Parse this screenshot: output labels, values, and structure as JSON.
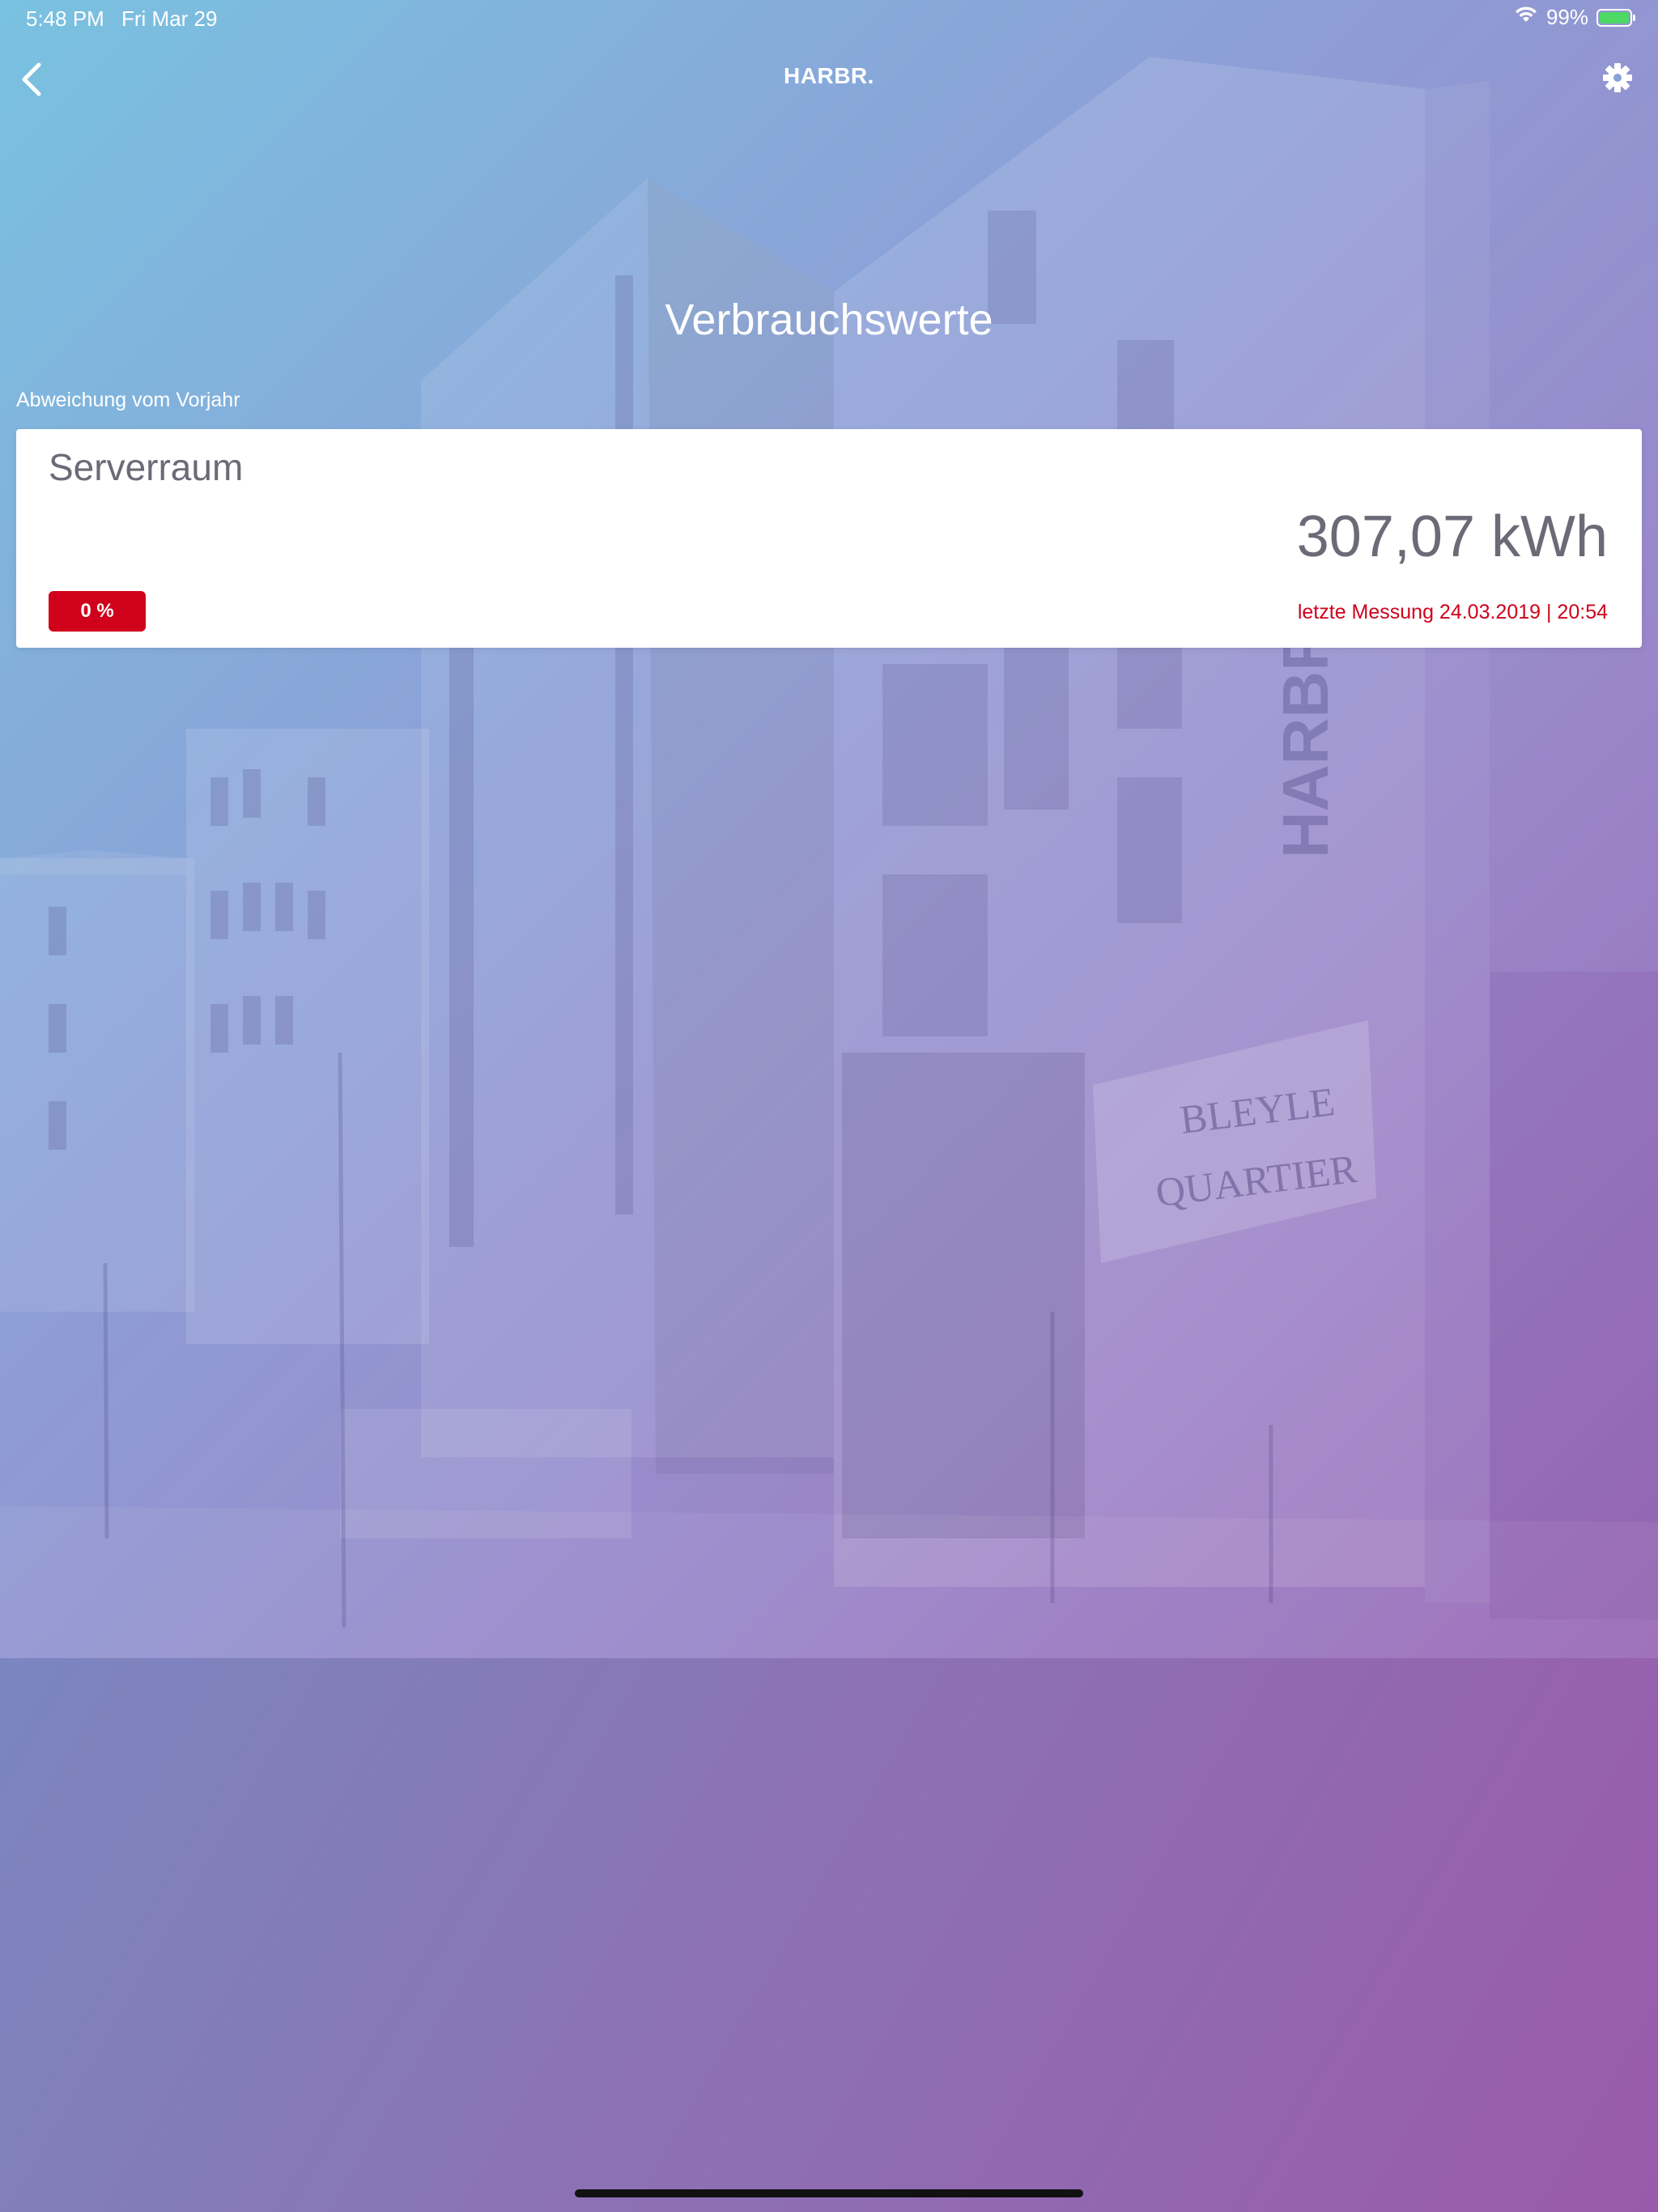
{
  "status_bar": {
    "time": "5:48 PM",
    "date": "Fri Mar 29",
    "battery_percent": "99%",
    "battery_level": 0.99,
    "wifi_icon": "wifi-icon",
    "battery_icon": "battery-charging-icon"
  },
  "nav": {
    "title": "HARBR.",
    "back_icon": "chevron-left-icon",
    "settings_icon": "gear-icon"
  },
  "main": {
    "heading": "Verbrauchswerte",
    "caption": "Abweichung vom Vorjahr",
    "card": {
      "name": "Serverraum",
      "value": "307,07 kWh",
      "deviation": "0 %",
      "last_measurement": "letzte Messung 24.03.2019 | 20:54"
    }
  },
  "background": {
    "sign_text_1": "BLEYLE",
    "sign_text_2": "QUARTIER",
    "facade_logo": "HARBR."
  },
  "colors": {
    "accent_red": "#d0021b",
    "card_text": "#6b6b78",
    "gradient_start": "#79c2e0",
    "gradient_end": "#9b5aae"
  }
}
